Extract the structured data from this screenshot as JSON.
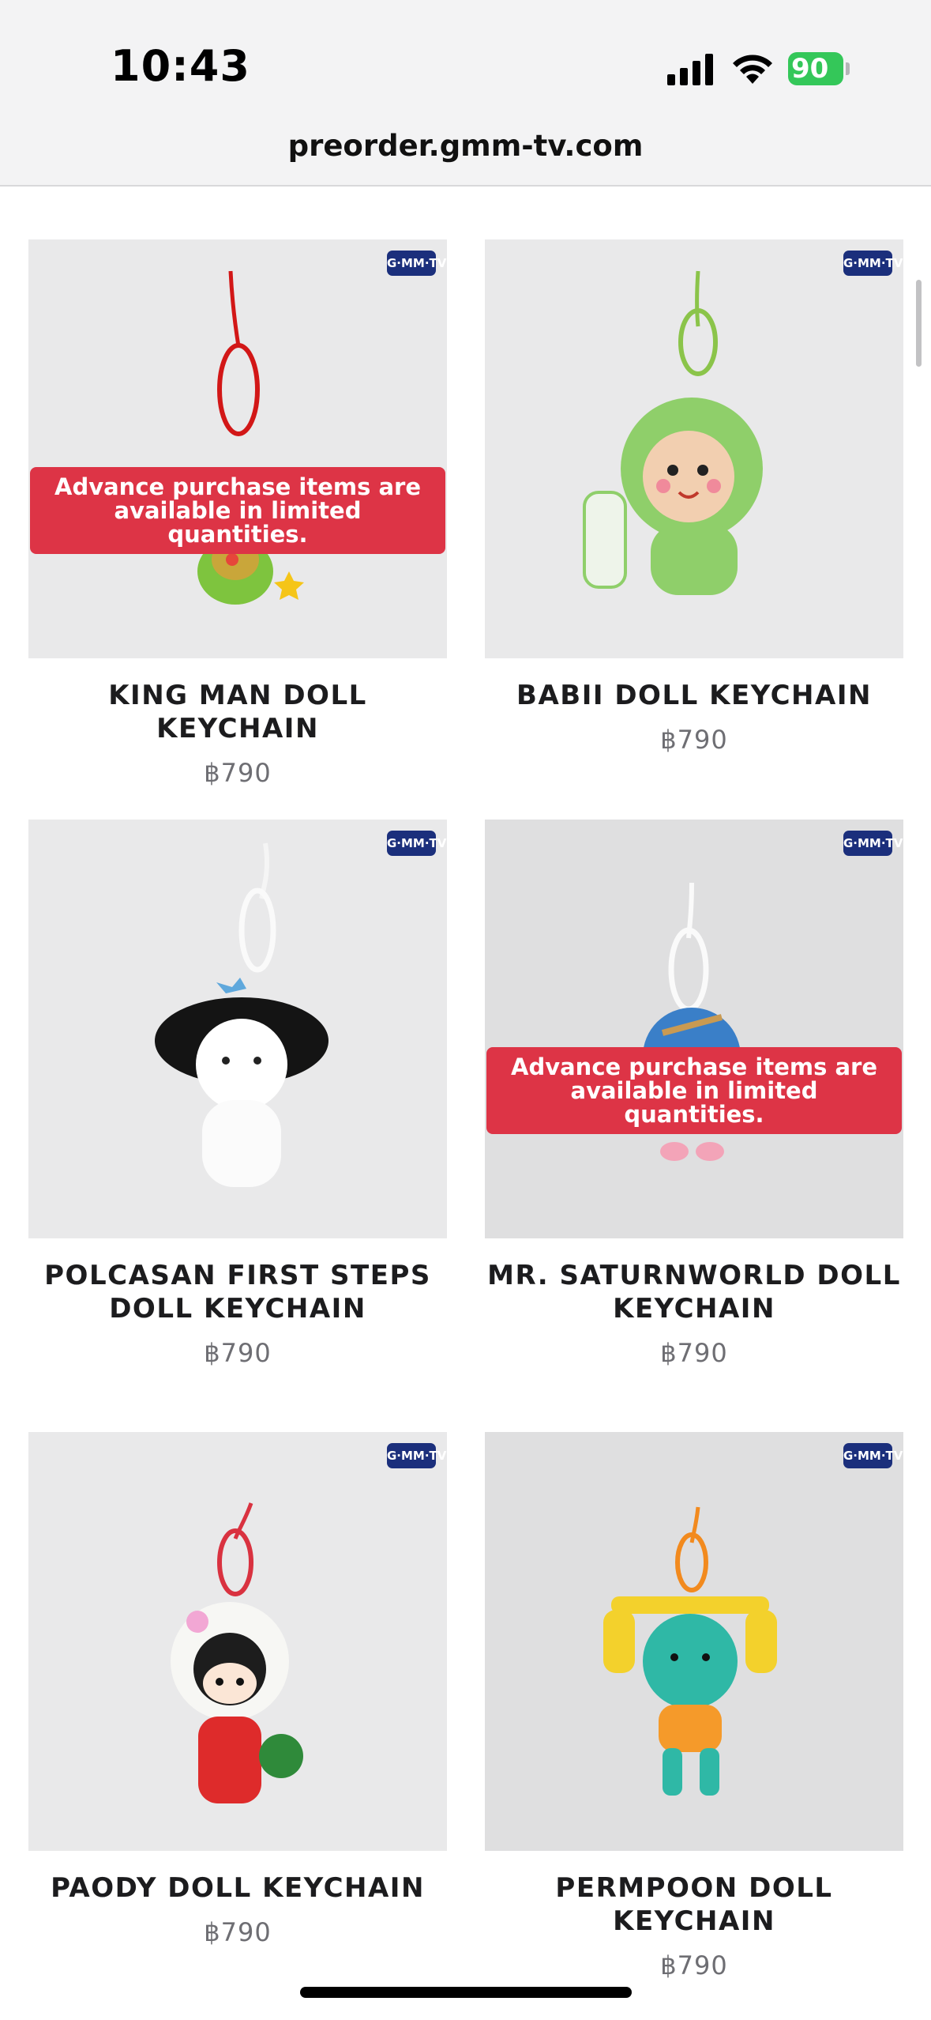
{
  "status_bar": {
    "time": "10:43",
    "battery": "90"
  },
  "browser": {
    "url": "preorder.gmm-tv.com"
  },
  "brand_badge": "G·MM·TV",
  "limited_notice": "Advance purchase items are available in limited quantities.",
  "products": [
    {
      "name": "KING MAN DOLL KEYCHAIN",
      "price": "฿790"
    },
    {
      "name": "BABII DOLL KEYCHAIN",
      "price": "฿790"
    },
    {
      "name": "POLCASAN FIRST STEPS DOLL KEYCHAIN",
      "price": "฿790"
    },
    {
      "name": "MR. SATURNWORLD DOLL KEYCHAIN",
      "price": "฿790"
    },
    {
      "name": "PAODY DOLL KEYCHAIN",
      "price": "฿790"
    },
    {
      "name": "PERMPOON DOLL KEYCHAIN",
      "price": "฿790"
    }
  ]
}
